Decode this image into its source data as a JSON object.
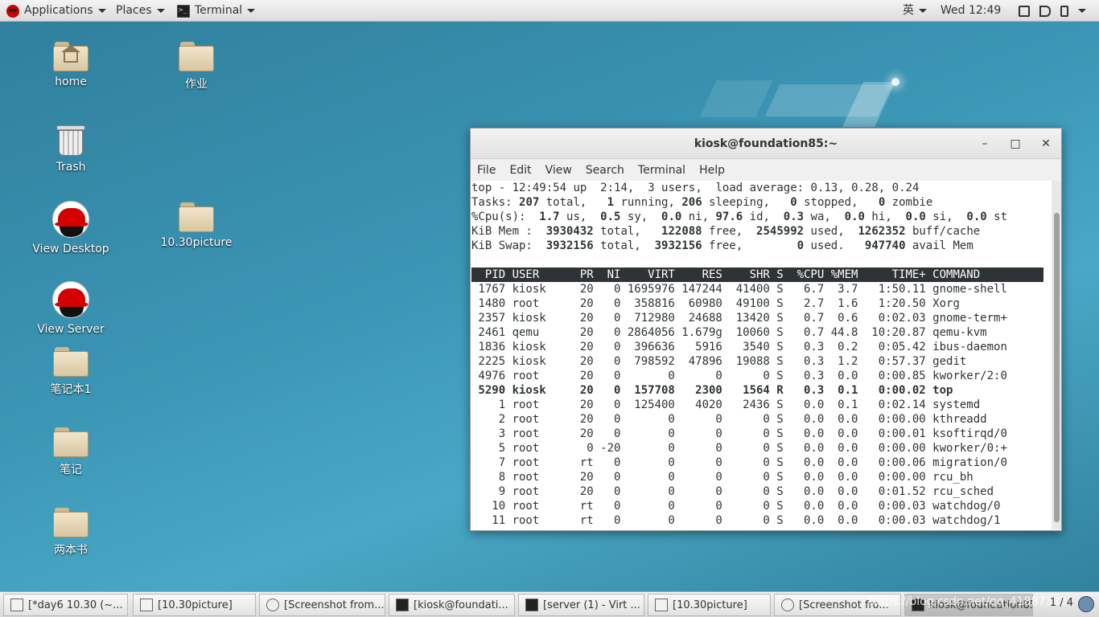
{
  "topbar": {
    "applications": "Applications",
    "places": "Places",
    "terminal": "Terminal",
    "input_method": "英",
    "clock": "Wed 12:49"
  },
  "desktop": {
    "icons": [
      {
        "label": "home"
      },
      {
        "label": "作业"
      },
      {
        "label": "Trash"
      },
      {
        "label": "View Desktop"
      },
      {
        "label": "10.30picture"
      },
      {
        "label": "View Server"
      },
      {
        "label": "笔记本1"
      },
      {
        "label": "笔记"
      },
      {
        "label": "两本书"
      }
    ]
  },
  "window": {
    "title": "kiosk@foundation85:~",
    "controls": {
      "minimize": "–",
      "maximize": "□",
      "close": "✕"
    },
    "menu": [
      "File",
      "Edit",
      "View",
      "Search",
      "Terminal",
      "Help"
    ]
  },
  "top": {
    "summary": {
      "time": "12:49:54",
      "uptime": "2:14",
      "users": "3",
      "load1": "0.13",
      "load5": "0.28",
      "load15": "0.24",
      "tasks_total": "207",
      "tasks_running": "1",
      "tasks_sleeping": "206",
      "tasks_stopped": "0",
      "tasks_zombie": "0",
      "cpu_us": "1.7",
      "cpu_sy": "0.5",
      "cpu_ni": "0.0",
      "cpu_id": "97.6",
      "cpu_wa": "0.3",
      "cpu_hi": "0.0",
      "cpu_si": "0.0",
      "cpu_st": "0.0",
      "mem_total": "3930432",
      "mem_free": "122088",
      "mem_used": "2545992",
      "mem_buff": "1262352",
      "swap_total": "3932156",
      "swap_free": "3932156",
      "swap_used": "0",
      "swap_avail": "947740"
    },
    "columns": [
      "PID",
      "USER",
      "PR",
      "NI",
      "VIRT",
      "RES",
      "SHR",
      "S",
      "%CPU",
      "%MEM",
      "TIME+",
      "COMMAND"
    ],
    "rows": [
      [
        "1767",
        "kiosk",
        "20",
        "0",
        "1695976",
        "147244",
        "41400",
        "S",
        "6.7",
        "3.7",
        "1:50.11",
        "gnome-shell"
      ],
      [
        "1480",
        "root",
        "20",
        "0",
        "358816",
        "60980",
        "49100",
        "S",
        "2.7",
        "1.6",
        "1:20.50",
        "Xorg"
      ],
      [
        "2357",
        "kiosk",
        "20",
        "0",
        "712980",
        "24688",
        "13420",
        "S",
        "0.7",
        "0.6",
        "0:02.03",
        "gnome-term+"
      ],
      [
        "2461",
        "qemu",
        "20",
        "0",
        "2864056",
        "1.679g",
        "10060",
        "S",
        "0.7",
        "44.8",
        "10:20.87",
        "qemu-kvm"
      ],
      [
        "1836",
        "kiosk",
        "20",
        "0",
        "396636",
        "5916",
        "3540",
        "S",
        "0.3",
        "0.2",
        "0:05.42",
        "ibus-daemon"
      ],
      [
        "2225",
        "kiosk",
        "20",
        "0",
        "798592",
        "47896",
        "19088",
        "S",
        "0.3",
        "1.2",
        "0:57.37",
        "gedit"
      ],
      [
        "4976",
        "root",
        "20",
        "0",
        "0",
        "0",
        "0",
        "S",
        "0.3",
        "0.0",
        "0:00.85",
        "kworker/2:0"
      ],
      [
        "5290",
        "kiosk",
        "20",
        "0",
        "157708",
        "2300",
        "1564",
        "R",
        "0.3",
        "0.1",
        "0:00.02",
        "top"
      ],
      [
        "1",
        "root",
        "20",
        "0",
        "125400",
        "4020",
        "2436",
        "S",
        "0.0",
        "0.1",
        "0:02.14",
        "systemd"
      ],
      [
        "2",
        "root",
        "20",
        "0",
        "0",
        "0",
        "0",
        "S",
        "0.0",
        "0.0",
        "0:00.00",
        "kthreadd"
      ],
      [
        "3",
        "root",
        "20",
        "0",
        "0",
        "0",
        "0",
        "S",
        "0.0",
        "0.0",
        "0:00.01",
        "ksoftirqd/0"
      ],
      [
        "5",
        "root",
        "0",
        "-20",
        "0",
        "0",
        "0",
        "S",
        "0.0",
        "0.0",
        "0:00.00",
        "kworker/0:+"
      ],
      [
        "7",
        "root",
        "rt",
        "0",
        "0",
        "0",
        "0",
        "S",
        "0.0",
        "0.0",
        "0:00.06",
        "migration/0"
      ],
      [
        "8",
        "root",
        "20",
        "0",
        "0",
        "0",
        "0",
        "S",
        "0.0",
        "0.0",
        "0:00.00",
        "rcu_bh"
      ],
      [
        "9",
        "root",
        "20",
        "0",
        "0",
        "0",
        "0",
        "S",
        "0.0",
        "0.0",
        "0:01.52",
        "rcu_sched"
      ],
      [
        "10",
        "root",
        "rt",
        "0",
        "0",
        "0",
        "0",
        "S",
        "0.0",
        "0.0",
        "0:00.03",
        "watchdog/0"
      ],
      [
        "11",
        "root",
        "rt",
        "0",
        "0",
        "0",
        "0",
        "S",
        "0.0",
        "0.0",
        "0:00.03",
        "watchdog/1"
      ]
    ],
    "highlight_pid": "5290"
  },
  "taskbar": {
    "tasks": [
      {
        "label": "[*day6 10.30 (~...",
        "icon": "file"
      },
      {
        "label": "[10.30picture]",
        "icon": "file"
      },
      {
        "label": "[Screenshot from...",
        "icon": "mag"
      },
      {
        "label": "[kiosk@foundati...",
        "icon": "term"
      },
      {
        "label": "[server (1) - Virt ...",
        "icon": "term"
      },
      {
        "label": "[10.30picture]",
        "icon": "file"
      },
      {
        "label": "[Screenshot fro...",
        "icon": "mag"
      },
      {
        "label": "kiosk@foundation85:~",
        "icon": "term"
      }
    ],
    "watermark": "https://blog.csdn.net/qq_41887386",
    "pager": "1 / 4"
  }
}
